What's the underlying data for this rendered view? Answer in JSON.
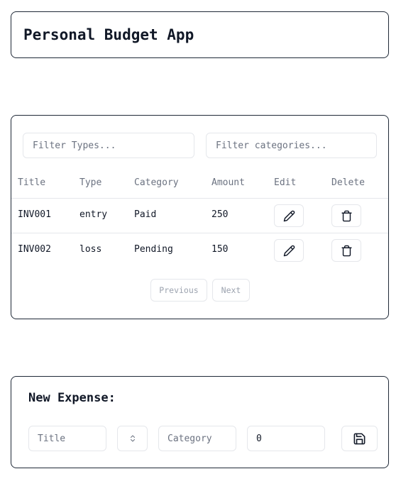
{
  "header": {
    "title": "Personal Budget App"
  },
  "filters": {
    "types_placeholder": "Filter Types...",
    "categories_placeholder": "Filter categories..."
  },
  "table": {
    "columns": [
      "Title",
      "Type",
      "Category",
      "Amount",
      "Edit",
      "Delete"
    ],
    "rows": [
      {
        "title": "INV001",
        "type": "entry",
        "category": "Paid",
        "amount": "250"
      },
      {
        "title": "INV002",
        "type": "loss",
        "category": "Pending",
        "amount": "150"
      }
    ]
  },
  "pagination": {
    "previous_label": "Previous",
    "next_label": "Next"
  },
  "form": {
    "title": "New Expense:",
    "title_placeholder": "Title",
    "category_placeholder": "Category",
    "amount_value": "0"
  },
  "icons": {
    "edit": "pencil-icon",
    "delete": "trash-icon",
    "select": "chevrons-up-down-icon",
    "save": "save-icon"
  },
  "colors": {
    "border": "#1f2937",
    "muted_text": "#6b7280",
    "divider": "#e5e7eb"
  }
}
